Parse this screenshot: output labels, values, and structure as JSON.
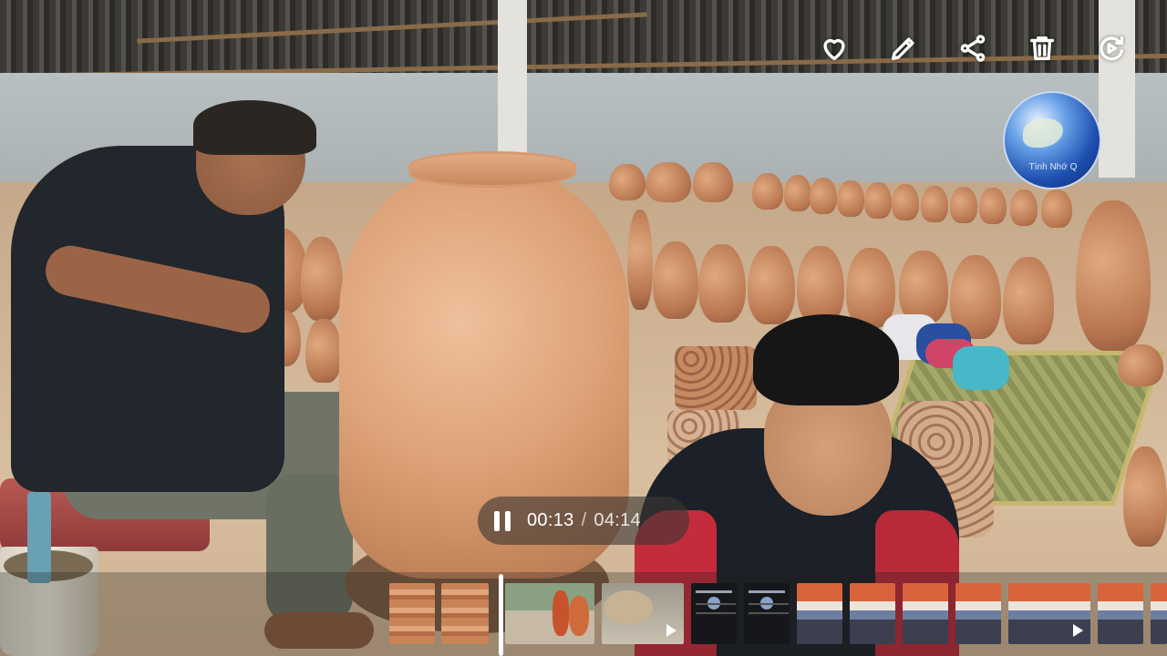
{
  "actions": {
    "like_icon": "heart-icon",
    "edit_icon": "pencil-icon",
    "share_icon": "share-icon",
    "delete_icon": "trash-icon",
    "remaster_icon": "video-remaster-icon"
  },
  "player": {
    "state": "playing",
    "pause_icon": "pause-icon",
    "current_time": "00:13",
    "separator": "/",
    "total_time": "04:14"
  },
  "watermark": {
    "icon": "globe-logo-icon",
    "text": "Tình Nhớ Q"
  },
  "timeline": {
    "thumbnails": [
      {
        "kind": "pots",
        "is_video": false
      },
      {
        "kind": "pots",
        "is_video": false
      },
      {
        "kind": "vases",
        "is_video": false
      },
      {
        "kind": "bowl",
        "is_video": true
      },
      {
        "kind": "screenshot",
        "is_video": false
      },
      {
        "kind": "screenshot",
        "is_video": false
      },
      {
        "kind": "group",
        "is_video": false
      },
      {
        "kind": "group",
        "is_video": false
      },
      {
        "kind": "group",
        "is_video": false
      },
      {
        "kind": "group",
        "is_video": false
      },
      {
        "kind": "group",
        "is_video": true
      },
      {
        "kind": "group",
        "is_video": false
      },
      {
        "kind": "group",
        "is_video": false
      }
    ]
  },
  "colors": {
    "overlay_pill": "#3c3734",
    "icon": "#ffffff"
  }
}
